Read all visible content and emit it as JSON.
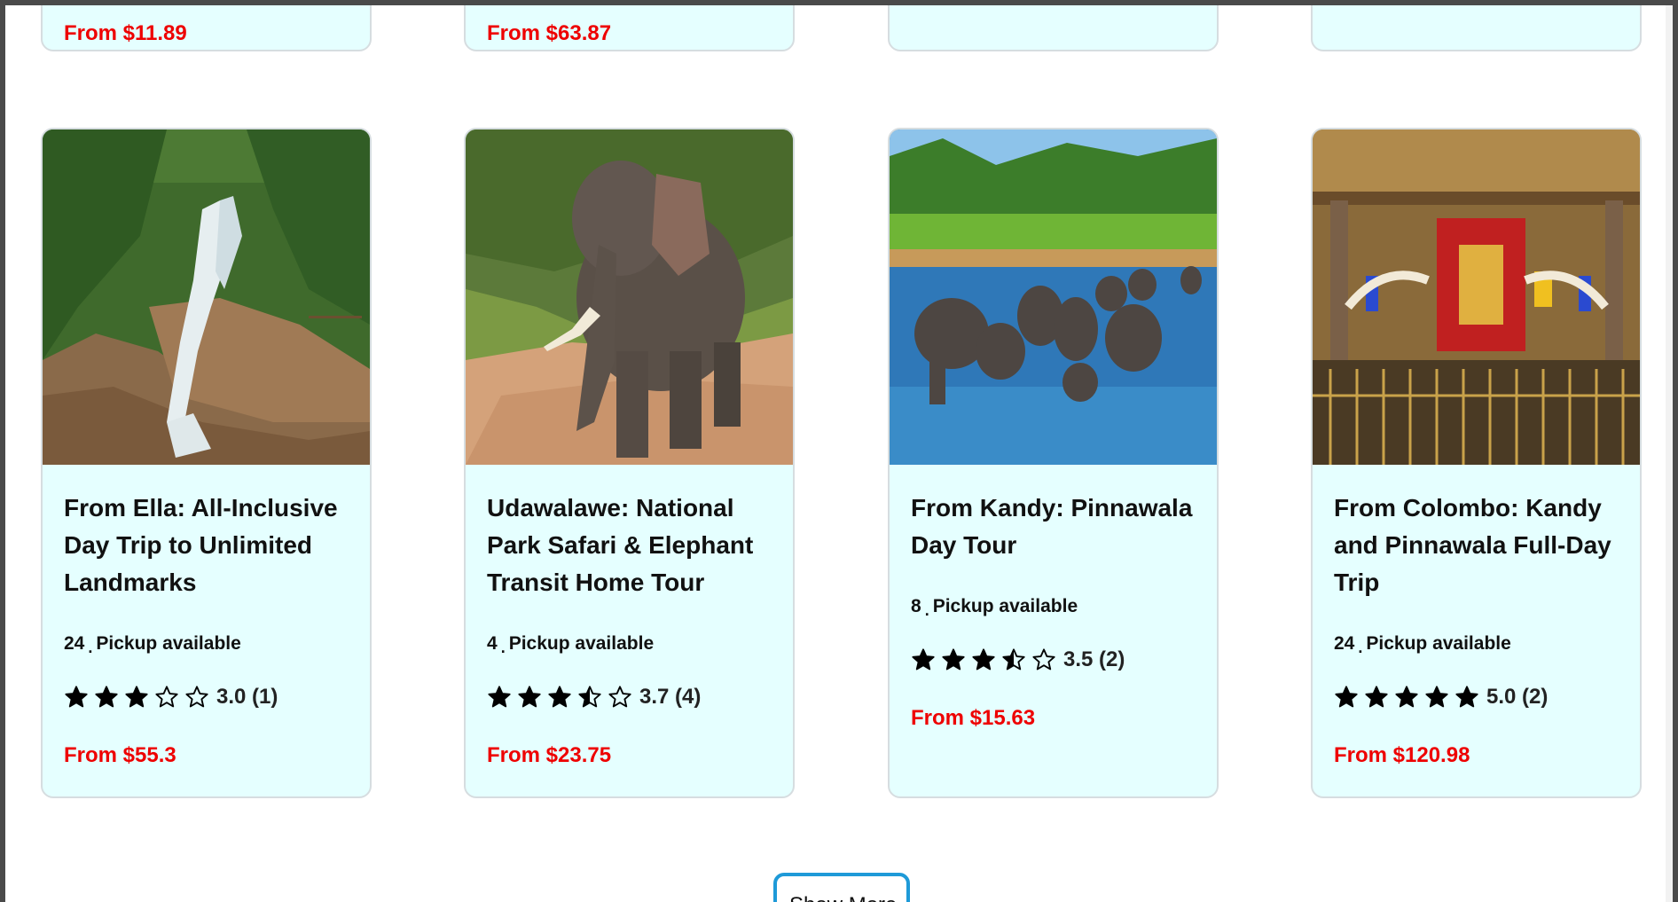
{
  "top_row": [
    {
      "price": "From $11.89"
    },
    {
      "price": "From $63.87"
    },
    {
      "price": ""
    },
    {
      "price": ""
    }
  ],
  "tours": [
    {
      "title": "From Ella: All-Inclusive Day Trip to Unlimited Landmarks",
      "count": "24",
      "sep": ".",
      "pickup": "Pickup available",
      "rating": 3.0,
      "rating_text": "3.0 (1)",
      "price": "From $55.3",
      "image": "waterfall-photo"
    },
    {
      "title": "Udawalawe: National Park Safari & Elephant Transit Home Tour",
      "count": "4",
      "sep": ".",
      "pickup": "Pickup available",
      "rating": 3.7,
      "rating_text": "3.7 (4)",
      "price": "From $23.75",
      "image": "elephant-photo"
    },
    {
      "title": "From Kandy: Pinnawala Day Tour",
      "count": "8",
      "sep": ".",
      "pickup": "Pickup available",
      "rating": 3.5,
      "rating_text": "3.5 (2)",
      "price": "From $15.63",
      "image": "elephant-herd-river-photo"
    },
    {
      "title": "From Colombo: Kandy and Pinnawala Full-Day Trip",
      "count": "24",
      "sep": ".",
      "pickup": "Pickup available",
      "rating": 5.0,
      "rating_text": "5.0 (2)",
      "price": "From $120.98",
      "image": "temple-photo"
    }
  ],
  "show_more": {
    "label": "Show More"
  },
  "colors": {
    "card_bg": "#e5ffff",
    "price": "#ee0000",
    "button_border": "#1e9ad8"
  }
}
